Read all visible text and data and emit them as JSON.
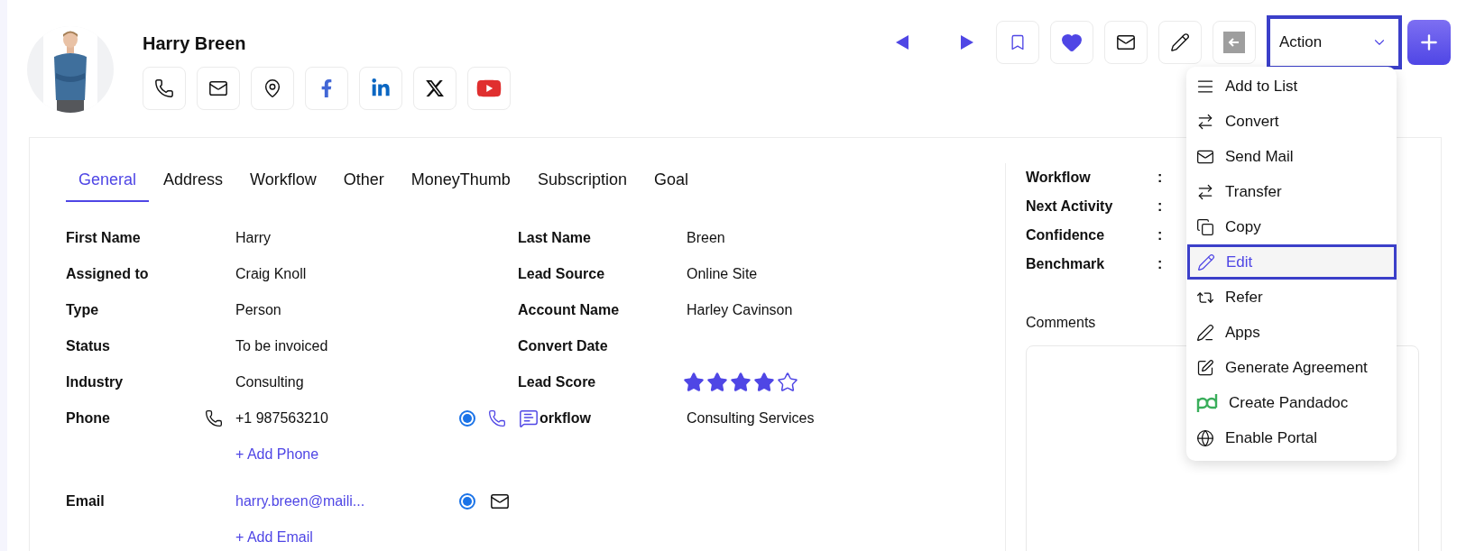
{
  "person": {
    "name": "Harry Breen"
  },
  "action_select": {
    "label": "Action",
    "expanded": true
  },
  "action_menu": [
    {
      "label": "Add to List",
      "selected": false
    },
    {
      "label": "Convert",
      "selected": false
    },
    {
      "label": "Send Mail",
      "selected": false
    },
    {
      "label": "Transfer",
      "selected": false
    },
    {
      "label": "Copy",
      "selected": false
    },
    {
      "label": "Edit",
      "selected": true
    },
    {
      "label": "Refer",
      "selected": false
    },
    {
      "label": "Apps",
      "selected": false
    },
    {
      "label": "Generate Agreement",
      "selected": false
    },
    {
      "label": "Create Pandadoc",
      "selected": false
    },
    {
      "label": "Enable Portal",
      "selected": false
    }
  ],
  "tabs": [
    {
      "label": "General",
      "selected": true
    },
    {
      "label": "Address",
      "selected": false
    },
    {
      "label": "Workflow",
      "selected": false
    },
    {
      "label": "Other",
      "selected": false
    },
    {
      "label": "MoneyThumb",
      "selected": false
    },
    {
      "label": "Subscription",
      "selected": false
    },
    {
      "label": "Goal",
      "selected": false
    }
  ],
  "fields_left": [
    {
      "kind": "text",
      "label": "First Name",
      "value": "Harry"
    },
    {
      "kind": "text",
      "label": "Assigned to",
      "value": "Craig Knoll"
    },
    {
      "kind": "text",
      "label": "Type",
      "value": "Person"
    },
    {
      "kind": "text",
      "label": "Status",
      "value": "To be invoiced"
    },
    {
      "kind": "text",
      "label": "Industry",
      "value": "Consulting"
    },
    {
      "kind": "phone",
      "label": "Phone",
      "value": "+1 987563210",
      "primary": true,
      "add_link": "+ Add Phone"
    },
    {
      "kind": "email",
      "label": "Email",
      "value": "harry.breen@maili...",
      "primary": true,
      "add_link": "+ Add Email"
    }
  ],
  "fields_right": [
    {
      "kind": "text",
      "label": "Last Name",
      "value": "Breen"
    },
    {
      "kind": "text",
      "label": "Lead Source",
      "value": "Online Site"
    },
    {
      "kind": "text",
      "label": "Account Name",
      "value": "Harley Cavinson"
    },
    {
      "kind": "text",
      "label": "Convert Date"
    },
    {
      "kind": "stars",
      "label": "Lead Score",
      "stars": 4
    },
    {
      "kind": "covered",
      "label": "orkflow",
      "value": "Consulting Services"
    }
  ],
  "summary": [
    {
      "label": "Workflow",
      "separator": ":"
    },
    {
      "label": "Next Activity",
      "separator": ":"
    },
    {
      "label": "Confidence",
      "separator": ":"
    },
    {
      "label": "Benchmark",
      "separator": ":"
    }
  ],
  "comments": {
    "label": "Comments"
  }
}
